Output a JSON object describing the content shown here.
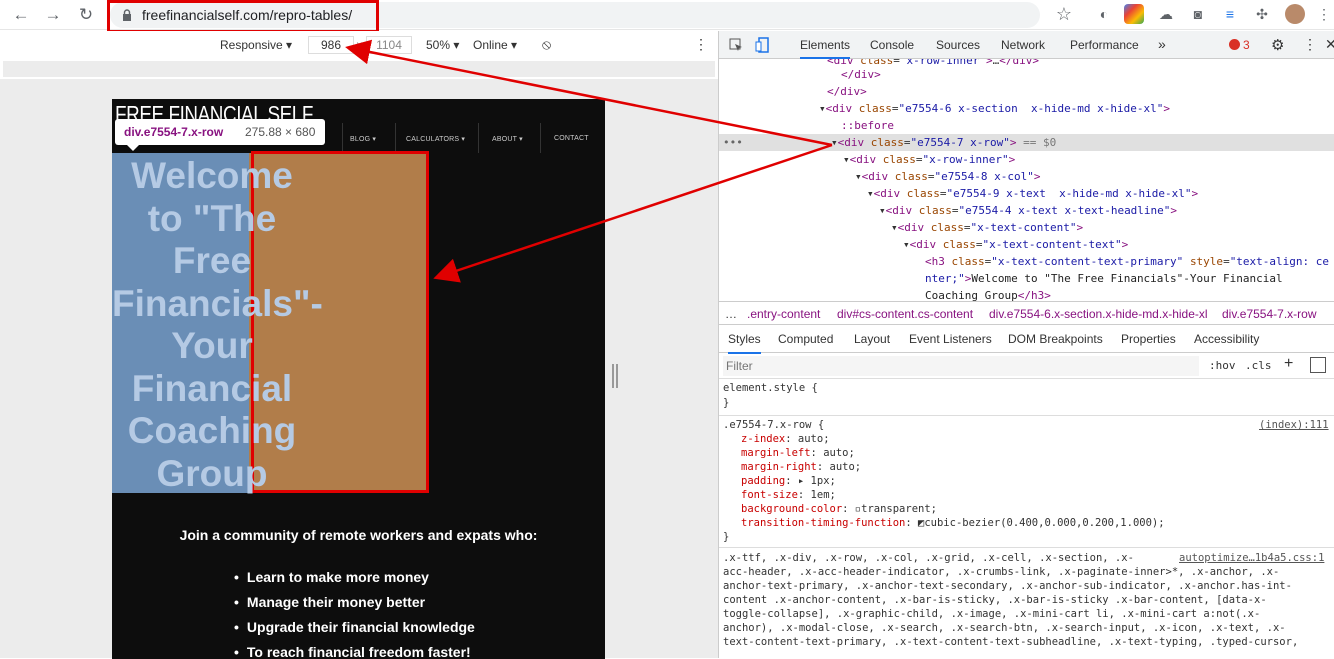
{
  "browser": {
    "back_icon": "←",
    "forward_icon": "→",
    "reload_icon": "↻",
    "url": "freefinancialself.com/repro-tables/",
    "star_icon": "☆"
  },
  "device_toolbar": {
    "mode": "Responsive ▾",
    "width": "986",
    "x": "×",
    "height": "1104",
    "zoom": "50% ▾",
    "network": "Online ▾"
  },
  "page": {
    "logo": "FREE FINANCIAL SELF",
    "nav": [
      "BLOG ▾",
      "CALCULATORS ▾",
      "ABOUT ▾",
      "CONTACT"
    ],
    "tooltip_name": "div.e7554-7.x-row",
    "tooltip_size": "275.88 × 680",
    "headline_lines": [
      "Welcome",
      "to \"The",
      "Free",
      "Financials\"-",
      "Your",
      "Financial",
      "Coaching",
      "Group"
    ],
    "subheadline": "Join a community of remote workers and expats who:",
    "bullets": [
      "Learn to make more money",
      "Manage their money better",
      "Upgrade their financial knowledge",
      "To reach financial freedom faster!"
    ]
  },
  "devtools": {
    "tabs": [
      "Elements",
      "Console",
      "Sources",
      "Network",
      "Performance",
      "»"
    ],
    "error_count": "3",
    "breadcrumbs": [
      "…",
      ".entry-content",
      "div#cs-content.cs-content",
      "div.e7554-6.x-section.x-hide-md.x-hide-xl",
      "div.e7554-7.x-row"
    ],
    "style_tabs": [
      "Styles",
      "Computed",
      "Layout",
      "Event Listeners",
      "DOM Breakpoints",
      "Properties",
      "Accessibility"
    ],
    "filter_placeholder": "Filter",
    "hov": ":hov",
    "cls": ".cls",
    "element_style": "element.style {",
    "rule_selector": ".e7554-7.x-row {",
    "rule_source": "(index):111",
    "source2": "autoptimize…1b4a5.css:1"
  }
}
